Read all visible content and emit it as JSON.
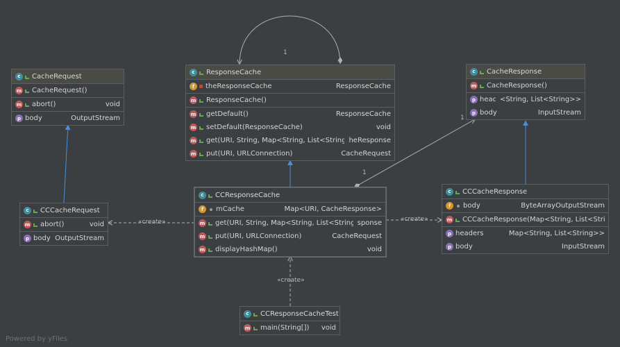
{
  "classes": {
    "cache_request": {
      "name": "CacheRequest",
      "methods": [
        {
          "name": "CacheRequest()",
          "type": ""
        },
        {
          "name": "abort()",
          "type": "void"
        }
      ],
      "props": [
        {
          "name": "body",
          "type": "OutputStream"
        }
      ]
    },
    "response_cache": {
      "name": "ResponseCache",
      "fields": [
        {
          "name": "theResponseCache",
          "type": "ResponseCache"
        }
      ],
      "ctors": [
        {
          "name": "ResponseCache()",
          "type": ""
        }
      ],
      "methods": [
        {
          "name": "getDefault()",
          "type": "ResponseCache"
        },
        {
          "name": "setDefault(ResponseCache)",
          "type": "void"
        },
        {
          "name": "get(URI, String, Map<String, List<String>>)",
          "type": "heResponse"
        },
        {
          "name": "put(URI, URLConnection)",
          "type": "CacheRequest"
        }
      ]
    },
    "cache_response": {
      "name": "CacheResponse",
      "methods": [
        {
          "name": "CacheResponse()",
          "type": ""
        }
      ],
      "props": [
        {
          "name": "headers",
          "type": "<String, List<String>>"
        },
        {
          "name": "body",
          "type": "InputStream"
        }
      ]
    },
    "cc_cache_request": {
      "name": "CCCacheRequest",
      "methods": [
        {
          "name": "abort()",
          "type": "void"
        }
      ],
      "props": [
        {
          "name": "body",
          "type": "OutputStream"
        }
      ]
    },
    "cc_response_cache": {
      "name": "CCResponseCache",
      "fields": [
        {
          "name": "mCache",
          "type": "Map<URI, CacheResponse>"
        }
      ],
      "methods": [
        {
          "name": "get(URI, String, Map<String, List<String>>)",
          "type": "sponse"
        },
        {
          "name": "put(URI, URLConnection)",
          "type": "CacheRequest"
        },
        {
          "name": "displayHashMap()",
          "type": "void"
        }
      ]
    },
    "cc_cache_response": {
      "name": "CCCacheResponse",
      "fields": [
        {
          "name": "body",
          "type": "ByteArrayOutputStream"
        }
      ],
      "methods": [
        {
          "name": "CCCacheResponse(Map<String, List<String>",
          "type": ""
        }
      ],
      "props": [
        {
          "name": "headers",
          "type": "Map<String, List<String>>"
        },
        {
          "name": "body",
          "type": "InputStream"
        }
      ]
    },
    "cc_response_cache_test": {
      "name": "CCResponseCacheTest",
      "methods": [
        {
          "name": "main(String[])",
          "type": "void"
        }
      ]
    }
  },
  "labels": {
    "self_mult": "1",
    "assoc_mult_top": "1",
    "assoc_mult_bottom": "1",
    "create_left": "«create»",
    "create_right": "«create»",
    "create_bottom": "«create»"
  },
  "footer": "Powered by yFiles",
  "colors": {
    "background": "#3c3f41",
    "inherit_arrow": "#4a90d9",
    "edge": "#b0b0b0"
  }
}
